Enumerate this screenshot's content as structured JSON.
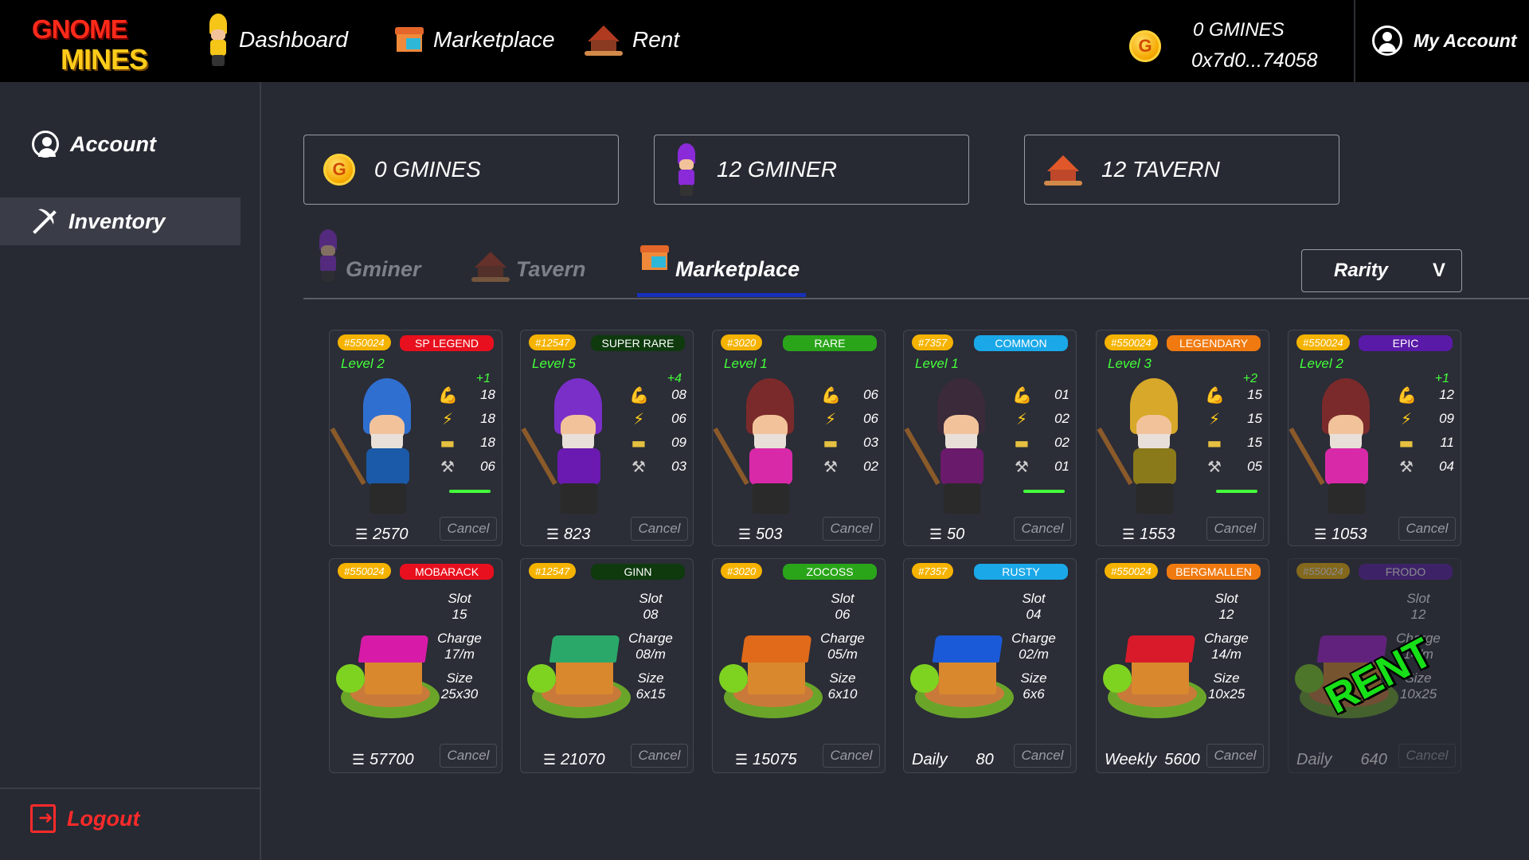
{
  "brand": {
    "line1": "GNOME",
    "line2": "MINES"
  },
  "nav": [
    {
      "label": "Dashboard",
      "icon": "gnome-icon"
    },
    {
      "label": "Marketplace",
      "icon": "shop-icon"
    },
    {
      "label": "Rent",
      "icon": "house-icon"
    }
  ],
  "wallet": {
    "balance": "0 GMINES",
    "address": "0x7d0...74058"
  },
  "account_menu": {
    "label": "My Account"
  },
  "sidebar": {
    "items": [
      {
        "label": "Account",
        "icon": "user-circle-icon",
        "active": false
      },
      {
        "label": "Inventory",
        "icon": "pickaxe-icon",
        "active": true
      }
    ],
    "logout": "Logout"
  },
  "summary": [
    {
      "label": "0 GMINES",
      "icon": "coin-icon"
    },
    {
      "label": "12 GMINER",
      "icon": "gnome-icon"
    },
    {
      "label": "12 TAVERN",
      "icon": "house-icon"
    }
  ],
  "tabs": [
    {
      "label": "Gminer",
      "active": false
    },
    {
      "label": "Tavern",
      "active": false
    },
    {
      "label": "Marketplace",
      "active": true
    }
  ],
  "filter": {
    "label": "Rarity",
    "chevron": "V"
  },
  "colors": {
    "accent": "#1730b8",
    "green": "#44ff3a",
    "badge_yellow": "#f5b300"
  },
  "miners": [
    {
      "id": "#550024",
      "rarity": "SP LEGEND",
      "rarity_color": "#e8101e",
      "level": "Level 2",
      "bonus": "+1",
      "stats": [
        "18",
        "18",
        "18",
        "06"
      ],
      "bar": true,
      "price": "2570",
      "cancel": "Cancel",
      "hat": "#2f6fd0",
      "body": "#1a5aa8"
    },
    {
      "id": "#12547",
      "rarity": "SUPER RARE",
      "rarity_color": "#0e3a0e",
      "level": "Level 5",
      "bonus": "+4",
      "stats": [
        "08",
        "06",
        "09",
        "03"
      ],
      "bar": false,
      "price": "823",
      "cancel": "Cancel",
      "hat": "#7a2fc8",
      "body": "#6a1ab0"
    },
    {
      "id": "#3020",
      "rarity": "RARE",
      "rarity_color": "#2aa51a",
      "level": "Level 1",
      "bonus": "",
      "stats": [
        "06",
        "06",
        "03",
        "02"
      ],
      "bar": false,
      "price": "503",
      "cancel": "Cancel",
      "hat": "#7a2a2a",
      "body": "#d82aa8"
    },
    {
      "id": "#7357",
      "rarity": "COMMON",
      "rarity_color": "#1aa8e8",
      "level": "Level 1",
      "bonus": "",
      "stats": [
        "01",
        "02",
        "02",
        "01"
      ],
      "bar": true,
      "price": "50",
      "cancel": "Cancel",
      "hat": "#3a2a3a",
      "body": "#6a1a6a"
    },
    {
      "id": "#550024",
      "rarity": "LEGENDARY",
      "rarity_color": "#f07a10",
      "level": "Level 3",
      "bonus": "+2",
      "stats": [
        "15",
        "15",
        "15",
        "05"
      ],
      "bar": true,
      "price": "1553",
      "cancel": "Cancel",
      "hat": "#d8a82a",
      "body": "#8a7a1a"
    },
    {
      "id": "#550024",
      "rarity": "EPIC",
      "rarity_color": "#5a1aa8",
      "level": "Level 2",
      "bonus": "+1",
      "stats": [
        "12",
        "09",
        "11",
        "04"
      ],
      "bar": false,
      "price": "1053",
      "cancel": "Cancel",
      "hat": "#7a2a2a",
      "body": "#d82aa8"
    }
  ],
  "taverns": [
    {
      "id": "#550024",
      "name": "MOBARACK",
      "name_color": "#e8101e",
      "slot_label": "Slot",
      "slot": "15",
      "charge_label": "Charge",
      "charge": "17/m",
      "size_label": "Size",
      "size": "25x30",
      "price_prefix": "",
      "price": "57700",
      "cancel": "Cancel",
      "roof": "#d81aa8",
      "dim": false,
      "rent": ""
    },
    {
      "id": "#12547",
      "name": "GINN",
      "name_color": "#0e3a0e",
      "slot_label": "Slot",
      "slot": "08",
      "charge_label": "Charge",
      "charge": "08/m",
      "size_label": "Size",
      "size": "6x15",
      "price_prefix": "",
      "price": "21070",
      "cancel": "Cancel",
      "roof": "#2aa86a",
      "dim": false,
      "rent": ""
    },
    {
      "id": "#3020",
      "name": "ZOCOSS",
      "name_color": "#2aa51a",
      "slot_label": "Slot",
      "slot": "06",
      "charge_label": "Charge",
      "charge": "05/m",
      "size_label": "Size",
      "size": "6x10",
      "price_prefix": "",
      "price": "15075",
      "cancel": "Cancel",
      "roof": "#e06a1a",
      "dim": false,
      "rent": ""
    },
    {
      "id": "#7357",
      "name": "RUSTY",
      "name_color": "#1aa8e8",
      "slot_label": "Slot",
      "slot": "04",
      "charge_label": "Charge",
      "charge": "02/m",
      "size_label": "Size",
      "size": "6x6",
      "price_prefix": "Daily",
      "price": "80",
      "cancel": "Cancel",
      "roof": "#1a5ad8",
      "dim": false,
      "rent": ""
    },
    {
      "id": "#550024",
      "name": "BERGMALLEN",
      "name_color": "#f07a10",
      "slot_label": "Slot",
      "slot": "12",
      "charge_label": "Charge",
      "charge": "14/m",
      "size_label": "Size",
      "size": "10x25",
      "price_prefix": "Weekly",
      "price": "5600",
      "cancel": "Cancel",
      "roof": "#d81a2a",
      "dim": false,
      "rent": ""
    },
    {
      "id": "#550024",
      "name": "FRODO",
      "name_color": "#5a1aa8",
      "slot_label": "Slot",
      "slot": "12",
      "charge_label": "Charge",
      "charge": "14/m",
      "size_label": "Size",
      "size": "10x25",
      "price_prefix": "Daily",
      "price": "640",
      "cancel": "Cancel",
      "roof": "#a81ad8",
      "dim": true,
      "rent": "RENT"
    }
  ]
}
